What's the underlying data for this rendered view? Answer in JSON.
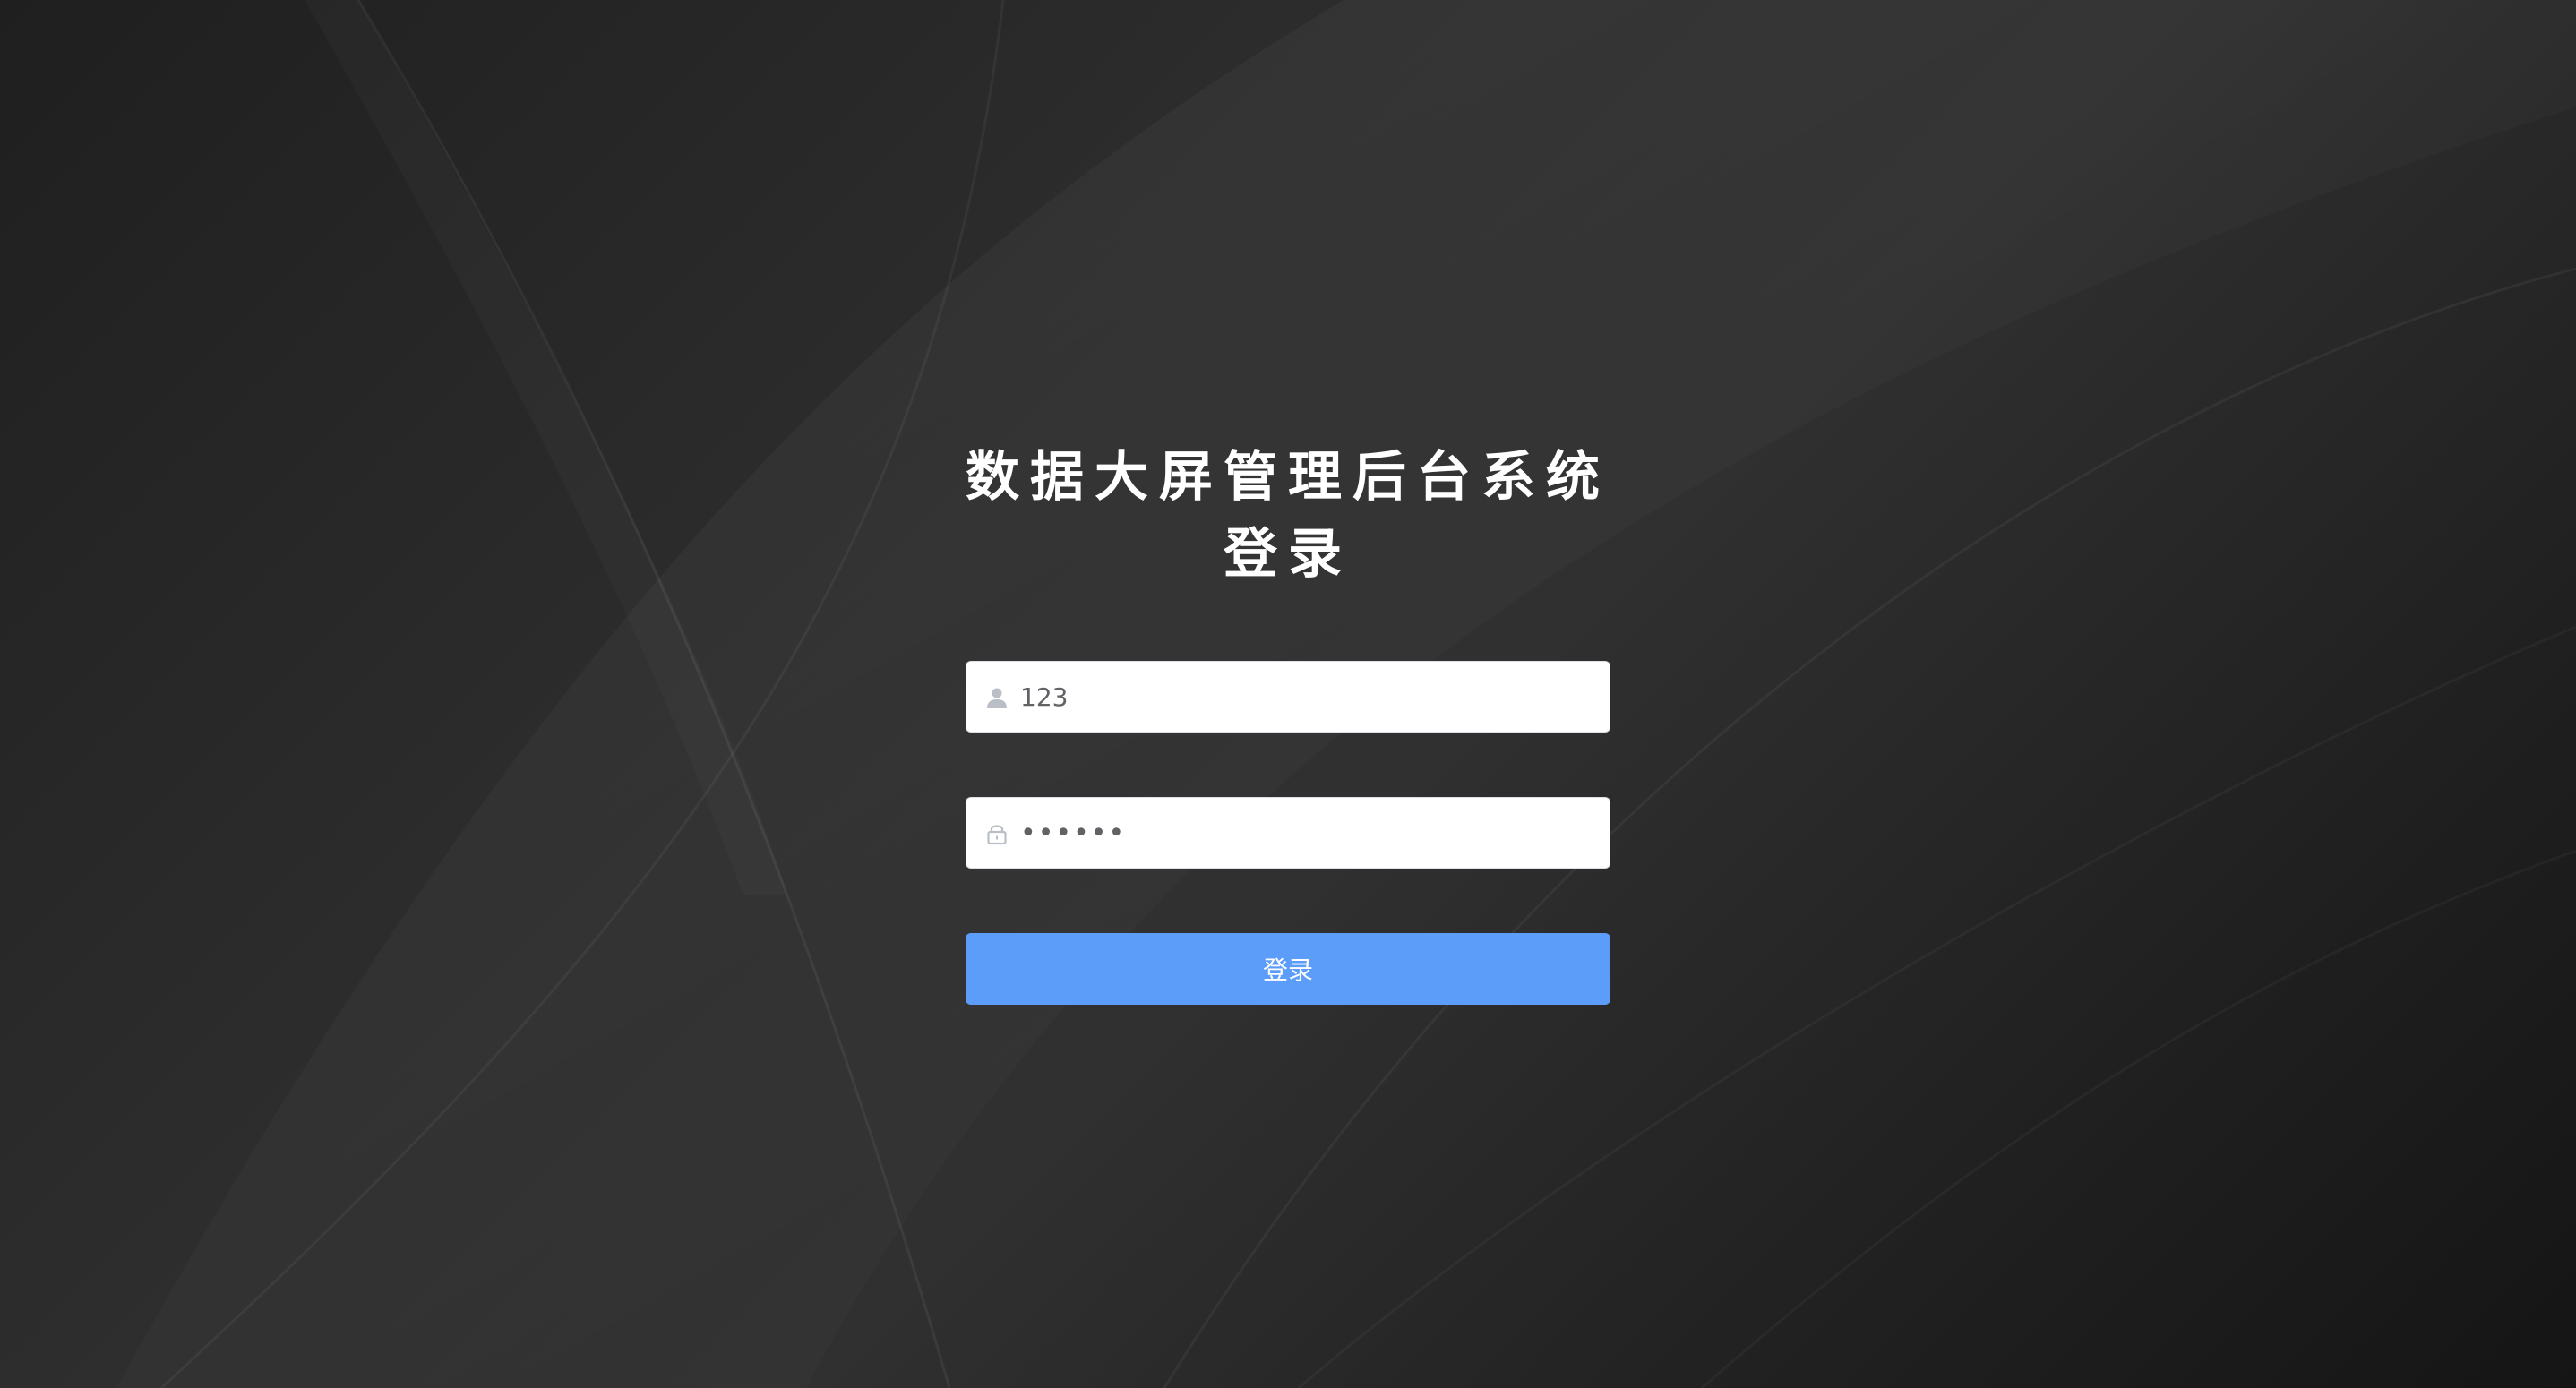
{
  "colors": {
    "background": "#2a2a2a",
    "title_text": "#ffffff",
    "input_background": "#ffffff",
    "icon": "#b9bec7",
    "button_background": "#5b9df8",
    "button_text": "#ffffff"
  },
  "login": {
    "title_line1": "数据大屏管理后台系统",
    "title_line2": "登录",
    "username": {
      "icon": "user-icon",
      "value": "123"
    },
    "password": {
      "icon": "lock-icon",
      "value": "123456"
    },
    "submit_label": "登录"
  }
}
